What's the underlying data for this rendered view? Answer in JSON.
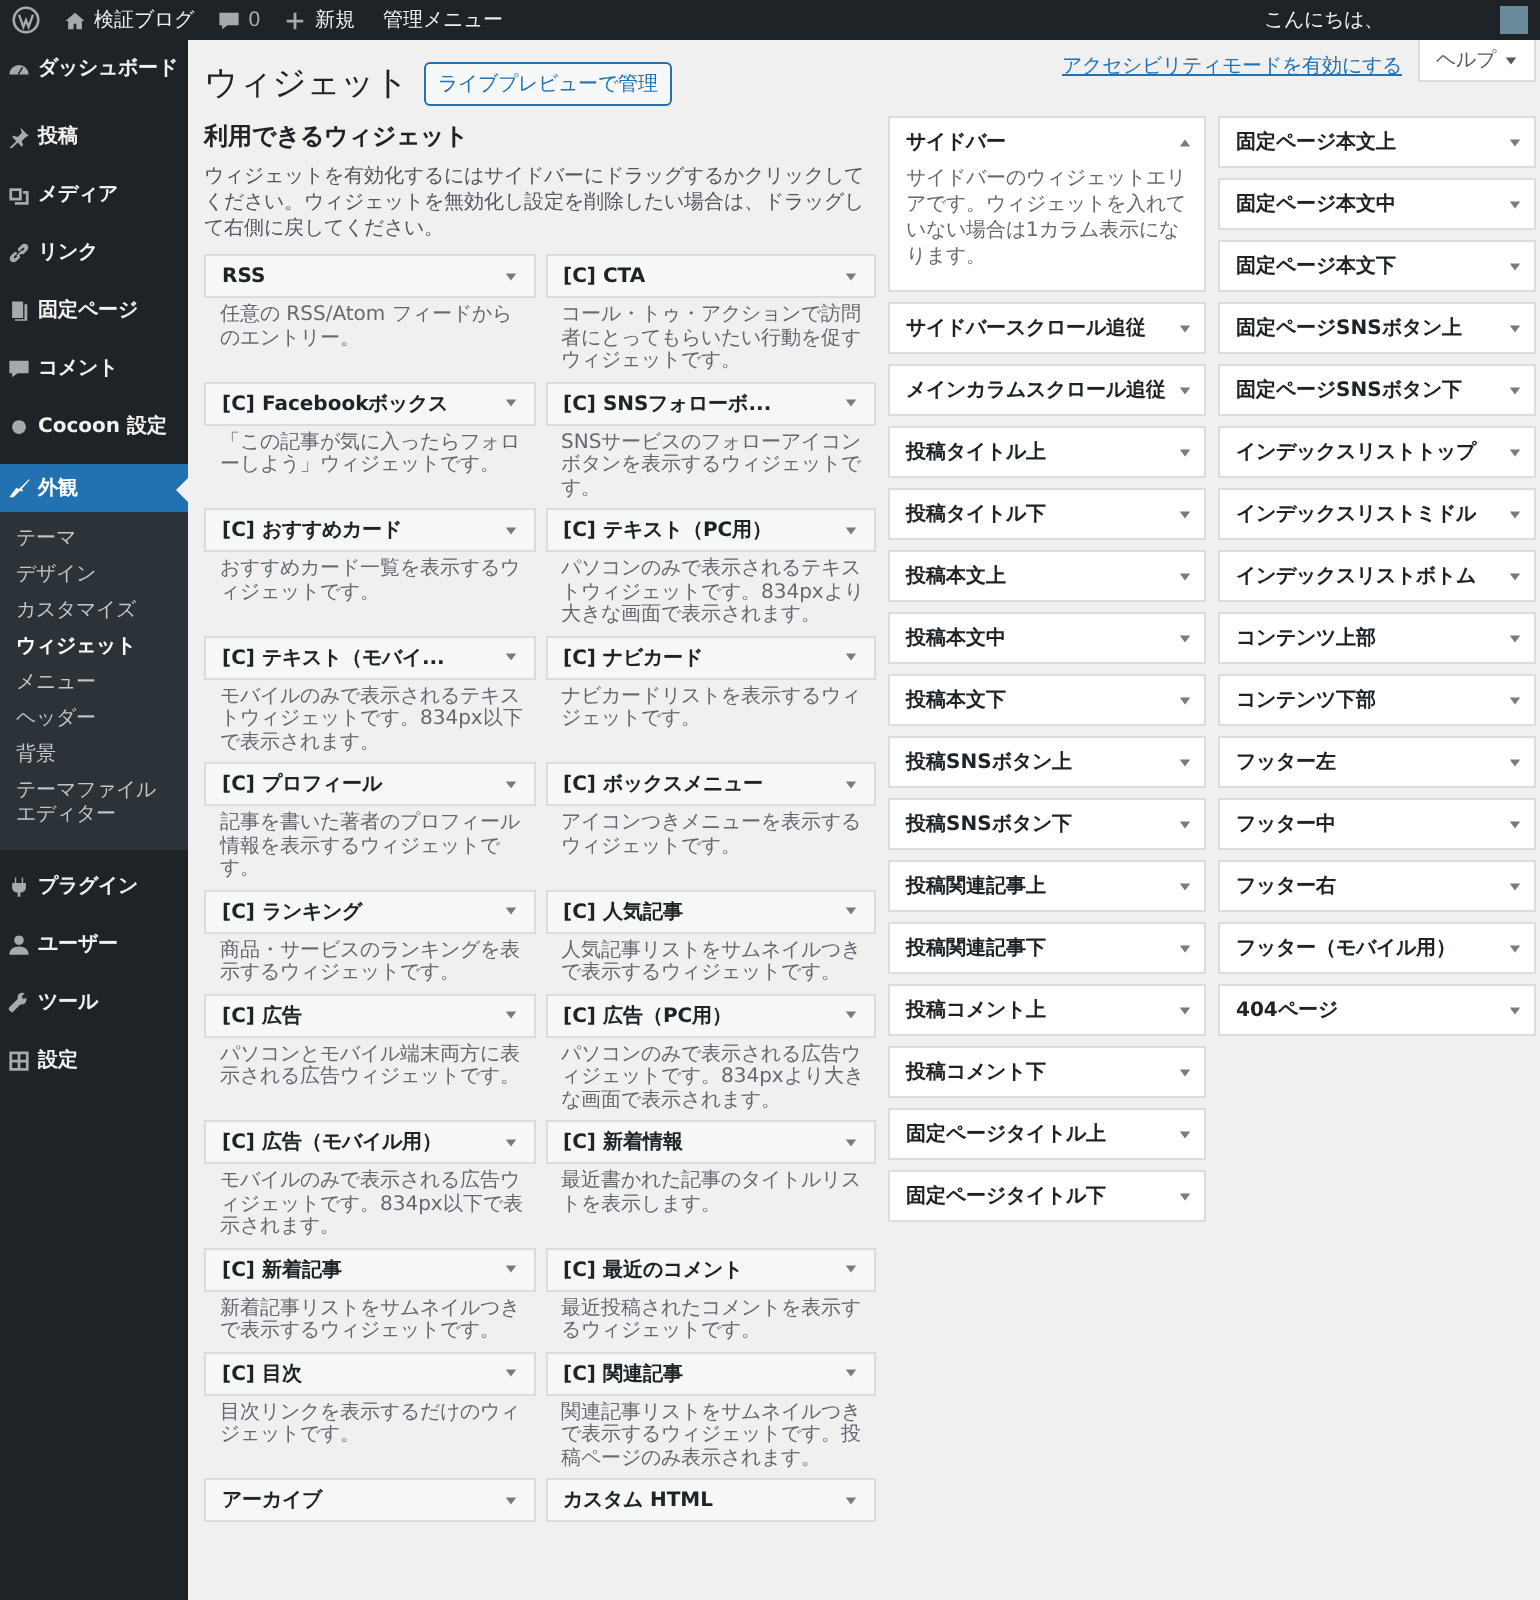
{
  "admin_bar": {
    "site_name": "検証ブログ",
    "comments": "0",
    "new": "新規",
    "manage": "管理メニュー",
    "greeting": "こんにちは、"
  },
  "sidebar": {
    "items": [
      {
        "label": "ダッシュボード",
        "selected": false
      },
      {
        "label": "投稿",
        "selected": false
      },
      {
        "label": "メディア",
        "selected": false
      },
      {
        "label": "リンク",
        "selected": false
      },
      {
        "label": "固定ページ",
        "selected": false
      },
      {
        "label": "コメント",
        "selected": false
      },
      {
        "label": "Cocoon 設定",
        "selected": false
      },
      {
        "label": "外観",
        "selected": true,
        "children": [
          {
            "label": "テーマ",
            "selected": false
          },
          {
            "label": "デザイン",
            "selected": false
          },
          {
            "label": "カスタマイズ",
            "selected": false
          },
          {
            "label": "ウィジェット",
            "selected": true
          },
          {
            "label": "メニュー",
            "selected": false
          },
          {
            "label": "ヘッダー",
            "selected": false
          },
          {
            "label": "背景",
            "selected": false
          },
          {
            "label": "テーマファイルエディター",
            "selected": false
          }
        ]
      },
      {
        "label": "プラグイン",
        "selected": false
      },
      {
        "label": "ユーザー",
        "selected": false
      },
      {
        "label": "ツール",
        "selected": false
      },
      {
        "label": "設定",
        "selected": false
      }
    ]
  },
  "page": {
    "title": "ウィジェット",
    "live_preview_button": "ライブプレビューで管理",
    "accessibility_link": "アクセシビリティモードを有効にする",
    "help_button": "ヘルプ"
  },
  "available_widgets": {
    "heading": "利用できるウィジェット",
    "intro": "ウィジェットを有効化するにはサイドバーにドラッグするかクリックしてください。ウィジェットを無効化し設定を削除したい場合は、ドラッグして右側に戻してください。",
    "widgets": [
      {
        "title": "RSS",
        "description": "任意の RSS/Atom フィードからのエントリー。"
      },
      {
        "title": "[C] CTA",
        "description": "コール・トゥ・アクションで訪問者にとってもらいたい行動を促すウィジェットです。"
      },
      {
        "title": "[C] Facebookボックス",
        "description": "「この記事が気に入ったらフォローしよう」ウィジェットです。"
      },
      {
        "title": "[C] SNSフォローボ...",
        "description": "SNSサービスのフォローアイコンボタンを表示するウィジェットです。"
      },
      {
        "title": "[C] おすすめカード",
        "description": "おすすめカード一覧を表示するウィジェットです。"
      },
      {
        "title": "[C] テキスト（PC用）",
        "description": "パソコンのみで表示されるテキストウィジェットです。834pxより大きな画面で表示されます。"
      },
      {
        "title": "[C] テキスト（モバイ...",
        "description": "モバイルのみで表示されるテキストウィジェットです。834px以下で表示されます。"
      },
      {
        "title": "[C] ナビカード",
        "description": "ナビカードリストを表示するウィジェットです。"
      },
      {
        "title": "[C] プロフィール",
        "description": "記事を書いた著者のプロフィール情報を表示するウィジェットです。"
      },
      {
        "title": "[C] ボックスメニュー",
        "description": "アイコンつきメニューを表示するウィジェットです。"
      },
      {
        "title": "[C] ランキング",
        "description": "商品・サービスのランキングを表示するウィジェットです。"
      },
      {
        "title": "[C] 人気記事",
        "description": "人気記事リストをサムネイルつきで表示するウィジェットです。"
      },
      {
        "title": "[C] 広告",
        "description": "パソコンとモバイル端末両方に表示される広告ウィジェットです。"
      },
      {
        "title": "[C] 広告（PC用）",
        "description": "パソコンのみで表示される広告ウィジェットです。834pxより大きな画面で表示されます。"
      },
      {
        "title": "[C] 広告（モバイル用）",
        "description": "モバイルのみで表示される広告ウィジェットです。834px以下で表示されます。"
      },
      {
        "title": "[C] 新着情報",
        "description": "最近書かれた記事のタイトルリストを表示します。"
      },
      {
        "title": "[C] 新着記事",
        "description": "新着記事リストをサムネイルつきで表示するウィジェットです。"
      },
      {
        "title": "[C] 最近のコメント",
        "description": "最近投稿されたコメントを表示するウィジェットです。"
      },
      {
        "title": "[C] 目次",
        "description": "目次リンクを表示するだけのウィジェットです。"
      },
      {
        "title": "[C] 関連記事",
        "description": "関連記事リストをサムネイルつきで表示するウィジェットです。投稿ページのみ表示されます。"
      },
      {
        "title": "アーカイブ"
      },
      {
        "title": "カスタム HTML"
      }
    ]
  },
  "widget_areas": [
    [
      {
        "title": "サイドバー",
        "expanded": true,
        "description": "サイドバーのウィジェットエリアです。ウィジェットを入れていない場合は1カラム表示になります。"
      },
      {
        "title": "サイドバースクロール追従",
        "expanded": false
      },
      {
        "title": "メインカラムスクロール追従",
        "expanded": false
      },
      {
        "title": "投稿タイトル上",
        "expanded": false
      },
      {
        "title": "投稿タイトル下",
        "expanded": false
      },
      {
        "title": "投稿本文上",
        "expanded": false
      },
      {
        "title": "投稿本文中",
        "expanded": false
      },
      {
        "title": "投稿本文下",
        "expanded": false
      },
      {
        "title": "投稿SNSボタン上",
        "expanded": false
      },
      {
        "title": "投稿SNSボタン下",
        "expanded": false
      },
      {
        "title": "投稿関連記事上",
        "expanded": false
      },
      {
        "title": "投稿関連記事下",
        "expanded": false
      },
      {
        "title": "投稿コメント上",
        "expanded": false
      },
      {
        "title": "投稿コメント下",
        "expanded": false
      },
      {
        "title": "固定ページタイトル上",
        "expanded": false
      },
      {
        "title": "固定ページタイトル下",
        "expanded": false
      }
    ],
    [
      {
        "title": "固定ページ本文上",
        "expanded": false
      },
      {
        "title": "固定ページ本文中",
        "expanded": false
      },
      {
        "title": "固定ページ本文下",
        "expanded": false
      },
      {
        "title": "固定ページSNSボタン上",
        "expanded": false
      },
      {
        "title": "固定ページSNSボタン下",
        "expanded": false
      },
      {
        "title": "インデックスリストトップ",
        "expanded": false
      },
      {
        "title": "インデックスリストミドル",
        "expanded": false
      },
      {
        "title": "インデックスリストボトム",
        "expanded": false
      },
      {
        "title": "コンテンツ上部",
        "expanded": false
      },
      {
        "title": "コンテンツ下部",
        "expanded": false
      },
      {
        "title": "フッター左",
        "expanded": false
      },
      {
        "title": "フッター中",
        "expanded": false
      },
      {
        "title": "フッター右",
        "expanded": false
      },
      {
        "title": "フッター（モバイル用）",
        "expanded": false
      },
      {
        "title": "404ページ",
        "expanded": false
      }
    ]
  ]
}
